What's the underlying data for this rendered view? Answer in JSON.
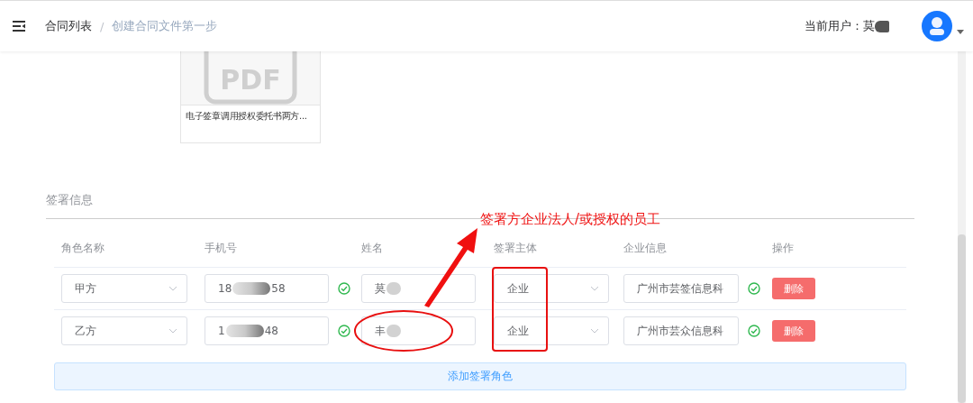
{
  "header": {
    "breadcrumb": [
      {
        "label": "合同列表",
        "selected": false
      },
      {
        "label": "创建合同文件第一步",
        "selected": true
      }
    ],
    "separator": "/",
    "user_label": "当前用户：",
    "user_name": "莫"
  },
  "file_card": {
    "icon_text": "PDF",
    "caption": "电子签章调用授权委托书两方..."
  },
  "signers": {
    "title": "签署信息",
    "columns": [
      "角色名称",
      "手机号",
      "姓名",
      "签署主体",
      "企业信息",
      "操作"
    ],
    "rows": [
      {
        "role": "甲方",
        "phone_start": "18",
        "phone_end": "58",
        "phone_verified": true,
        "name": "莫",
        "subject": "企业",
        "company": "广州市芸签信息科",
        "company_verified": true,
        "action": "删除"
      },
      {
        "role": "乙方",
        "phone_start": "1",
        "phone_end": "48",
        "phone_verified": true,
        "name": "丰",
        "subject": "企业",
        "company": "广州市芸众信息科",
        "company_verified": true,
        "action": "删除"
      }
    ],
    "add_button": "添加签署角色"
  },
  "annotation": {
    "text": "签署方企业法人/或授权的员工"
  }
}
